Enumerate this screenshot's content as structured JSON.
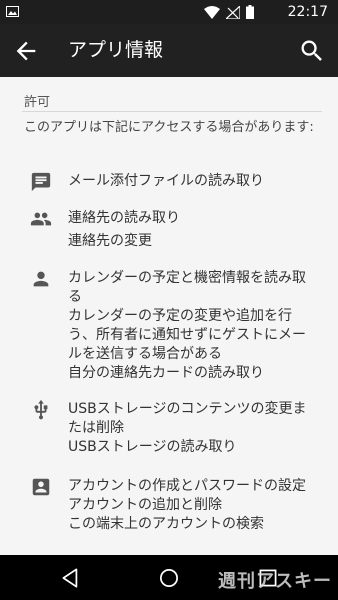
{
  "status_bar": {
    "time": "22:17"
  },
  "app_bar": {
    "title": "アプリ情報"
  },
  "section": {
    "header": "許可",
    "intro": "このアプリは下記にアクセスする場合があります:"
  },
  "permissions": [
    {
      "icon": "message-icon",
      "lines": [
        "メール添付ファイルの読み取り"
      ]
    },
    {
      "icon": "people-icon",
      "lines": [
        "連絡先の読み取り",
        "連絡先の変更"
      ]
    },
    {
      "icon": "person-icon",
      "lines": [
        "カレンダーの予定と機密情報を読み取る",
        "カレンダーの予定の変更や追加を行う、所有者に通知せずにゲストにメールを送信する場合がある",
        "自分の連絡先カードの読み取り"
      ]
    },
    {
      "icon": "usb-icon",
      "lines": [
        "USBストレージのコンテンツの変更または削除",
        "USBストレージの読み取り"
      ]
    },
    {
      "icon": "account-box-icon",
      "lines": [
        "アカウントの作成とパスワードの設定",
        "アカウントの追加と削除",
        "この端末上のアカウントの検索"
      ]
    }
  ],
  "watermark": "週刊アスキー",
  "colors": {
    "app_bar": "#212121",
    "status_bar": "#1e1e1e",
    "background": "#f5f5f5",
    "icon": "#555555"
  }
}
